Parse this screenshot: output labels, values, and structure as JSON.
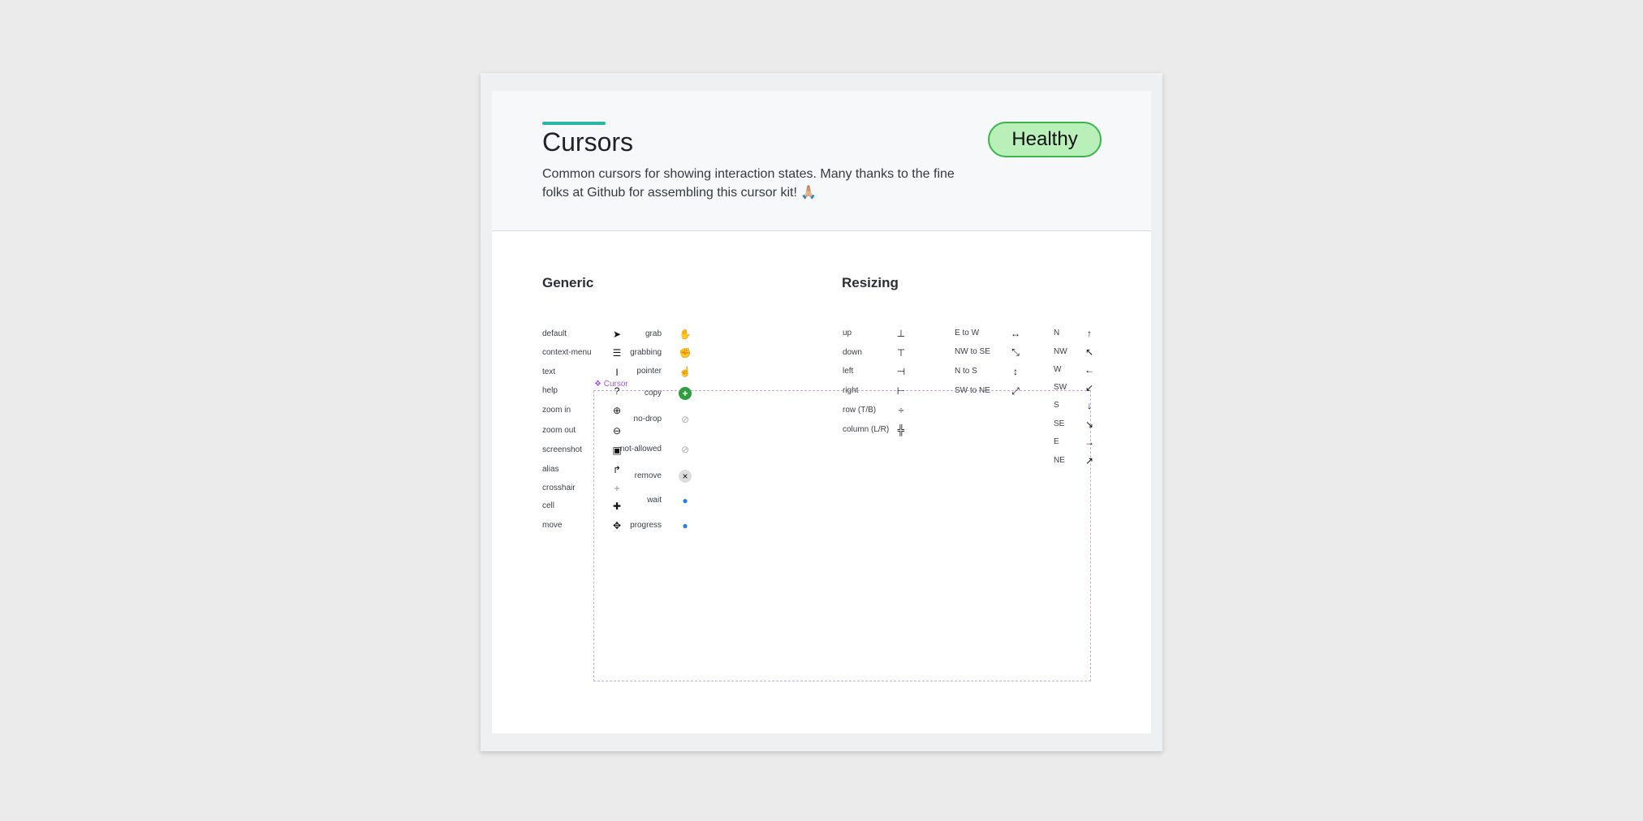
{
  "header": {
    "title": "Cursors",
    "description": "Common cursors for showing interaction states. Many thanks to the fine folks at Github for assembling this cursor kit! 🙏🏼",
    "badge": "Healthy"
  },
  "sections": {
    "generic": "Generic",
    "resizing": "Resizing"
  },
  "frame_label": "Cursor",
  "generic_left": [
    {
      "label": "default",
      "icon": "arrow-cursor-icon"
    },
    {
      "label": "context-menu",
      "icon": "context-menu-cursor-icon"
    },
    {
      "label": "text",
      "icon": "i-beam-cursor-icon"
    },
    {
      "label": "help",
      "icon": "help-cursor-icon"
    },
    {
      "label": "zoom in",
      "icon": "zoom-in-cursor-icon"
    },
    {
      "label": "zoom out",
      "icon": "zoom-out-cursor-icon"
    },
    {
      "label": "screenshot",
      "icon": "camera-cursor-icon"
    },
    {
      "label": "alias",
      "icon": "alias-cursor-icon"
    },
    {
      "label": "crosshair",
      "icon": "crosshair-cursor-icon"
    },
    {
      "label": "cell",
      "icon": "cell-cursor-icon"
    },
    {
      "label": "move",
      "icon": "move-cursor-icon"
    }
  ],
  "generic_right": [
    {
      "label": "grab",
      "icon": "open-hand-cursor-icon"
    },
    {
      "label": "grabbing",
      "icon": "closed-hand-cursor-icon"
    },
    {
      "label": "pointer",
      "icon": "pointing-hand-cursor-icon"
    },
    {
      "label": "copy",
      "icon": "copy-cursor-icon"
    },
    {
      "label": "no-drop",
      "icon": "no-drop-cursor-icon"
    },
    {
      "label": "not-allowed",
      "icon": "not-allowed-cursor-icon"
    },
    {
      "label": "remove",
      "icon": "remove-cursor-icon"
    },
    {
      "label": "wait",
      "icon": "wait-cursor-icon"
    },
    {
      "label": "progress",
      "icon": "progress-cursor-icon"
    }
  ],
  "resize_col1": [
    {
      "label": "up",
      "icon": "resize-up-cursor-icon"
    },
    {
      "label": "down",
      "icon": "resize-down-cursor-icon"
    },
    {
      "label": "left",
      "icon": "resize-left-cursor-icon"
    },
    {
      "label": "right",
      "icon": "resize-right-cursor-icon"
    },
    {
      "label": "row (T/B)",
      "icon": "row-resize-cursor-icon"
    },
    {
      "label": "column (L/R)",
      "icon": "column-resize-cursor-icon"
    }
  ],
  "resize_col2": [
    {
      "label": "E to W",
      "icon": "ew-resize-cursor-icon"
    },
    {
      "label": "NW to SE",
      "icon": "nwse-resize-cursor-icon"
    },
    {
      "label": "N to S",
      "icon": "ns-resize-cursor-icon"
    },
    {
      "label": "SW to NE",
      "icon": "nesw-resize-cursor-icon"
    }
  ],
  "resize_col3": [
    {
      "label": "N",
      "icon": "n-resize-cursor-icon"
    },
    {
      "label": "NW",
      "icon": "nw-resize-cursor-icon"
    },
    {
      "label": "W",
      "icon": "w-resize-cursor-icon"
    },
    {
      "label": "SW",
      "icon": "sw-resize-cursor-icon"
    },
    {
      "label": "S",
      "icon": "s-resize-cursor-icon"
    },
    {
      "label": "SE",
      "icon": "se-resize-cursor-icon"
    },
    {
      "label": "E",
      "icon": "e-resize-cursor-icon"
    },
    {
      "label": "NE",
      "icon": "ne-resize-cursor-icon"
    }
  ]
}
